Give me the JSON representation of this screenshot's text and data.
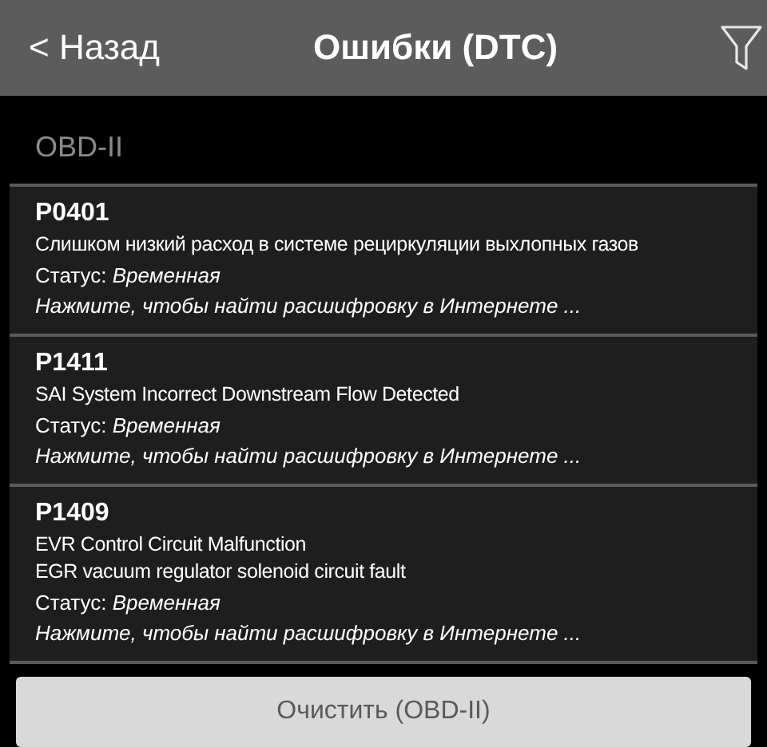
{
  "header": {
    "back": "< Назад",
    "title": "Ошибки (DTC)"
  },
  "section": "OBD-II",
  "codes": [
    {
      "code": "P0401",
      "descriptions": [
        "Слишком низкий расход в системе рециркуляции выхлопных газов"
      ],
      "status": "Статус: *Временная*",
      "link": "Нажмите, чтобы найти расшифровку в Интернете ..."
    },
    {
      "code": "P1411",
      "descriptions": [
        "SAI System Incorrect Downstream Flow Detected"
      ],
      "status": "Статус: *Временная*",
      "link": "Нажмите, чтобы найти расшифровку в Интернете ..."
    },
    {
      "code": "P1409",
      "descriptions": [
        "EVR Control Circuit Malfunction",
        "EGR vacuum regulator solenoid circuit fault"
      ],
      "status": "Статус: *Временная*",
      "link": "Нажмите, чтобы найти расшифровку в Интернете ..."
    }
  ],
  "clear_button": "Очистить (OBD-II)"
}
